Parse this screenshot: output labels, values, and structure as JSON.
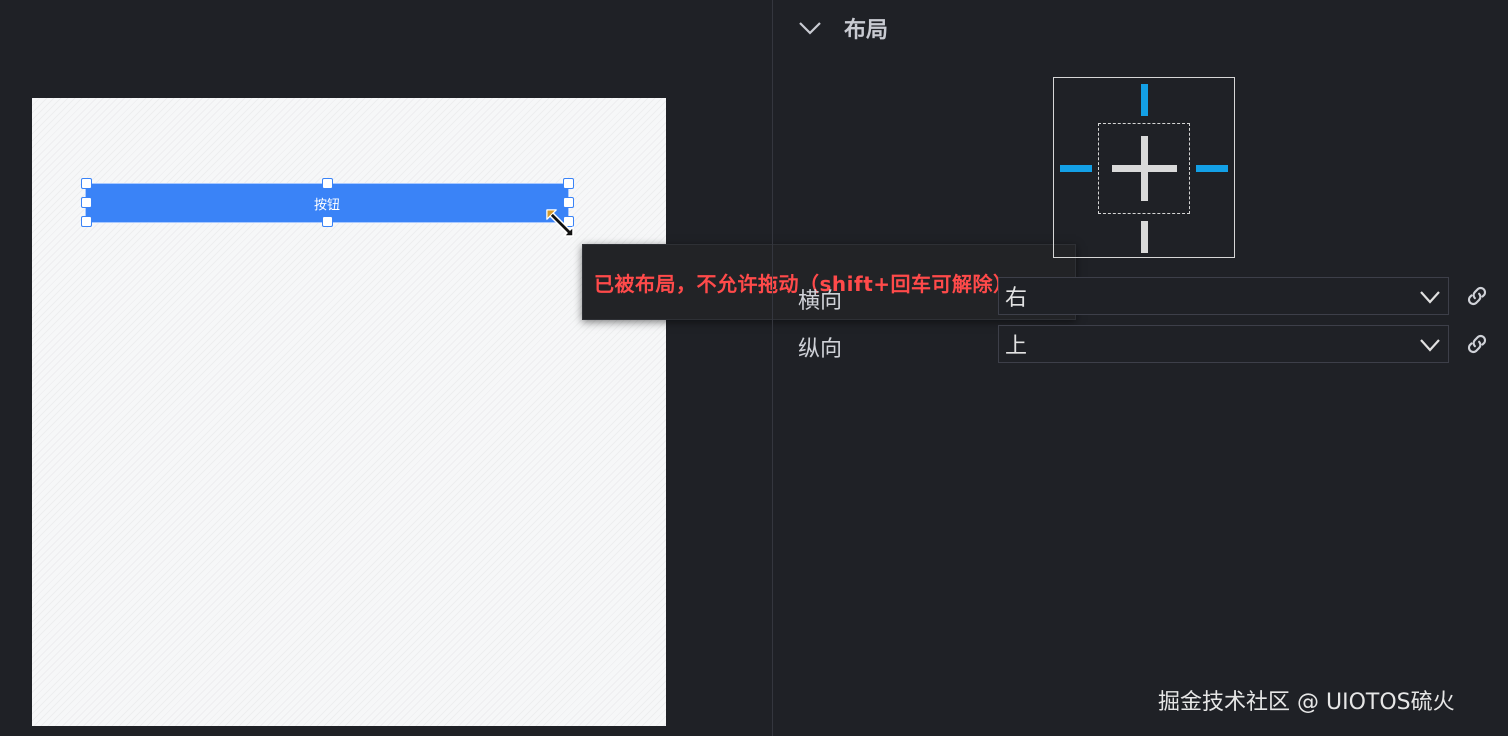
{
  "canvas": {
    "button_label": "按钮",
    "drag_warning": "已被布局，不允许拖动（shift+回车可解除）"
  },
  "panel": {
    "section_title": "布局",
    "horizontal": {
      "label": "横向",
      "value": "右"
    },
    "vertical": {
      "label": "纵向",
      "value": "上"
    }
  },
  "watermark": "掘金技术社区 @ UIOTOS硫火",
  "colors": {
    "accent_blue": "#3a83f7",
    "anchor_active": "#13a0e6",
    "warning_red": "#ff4a4a"
  }
}
